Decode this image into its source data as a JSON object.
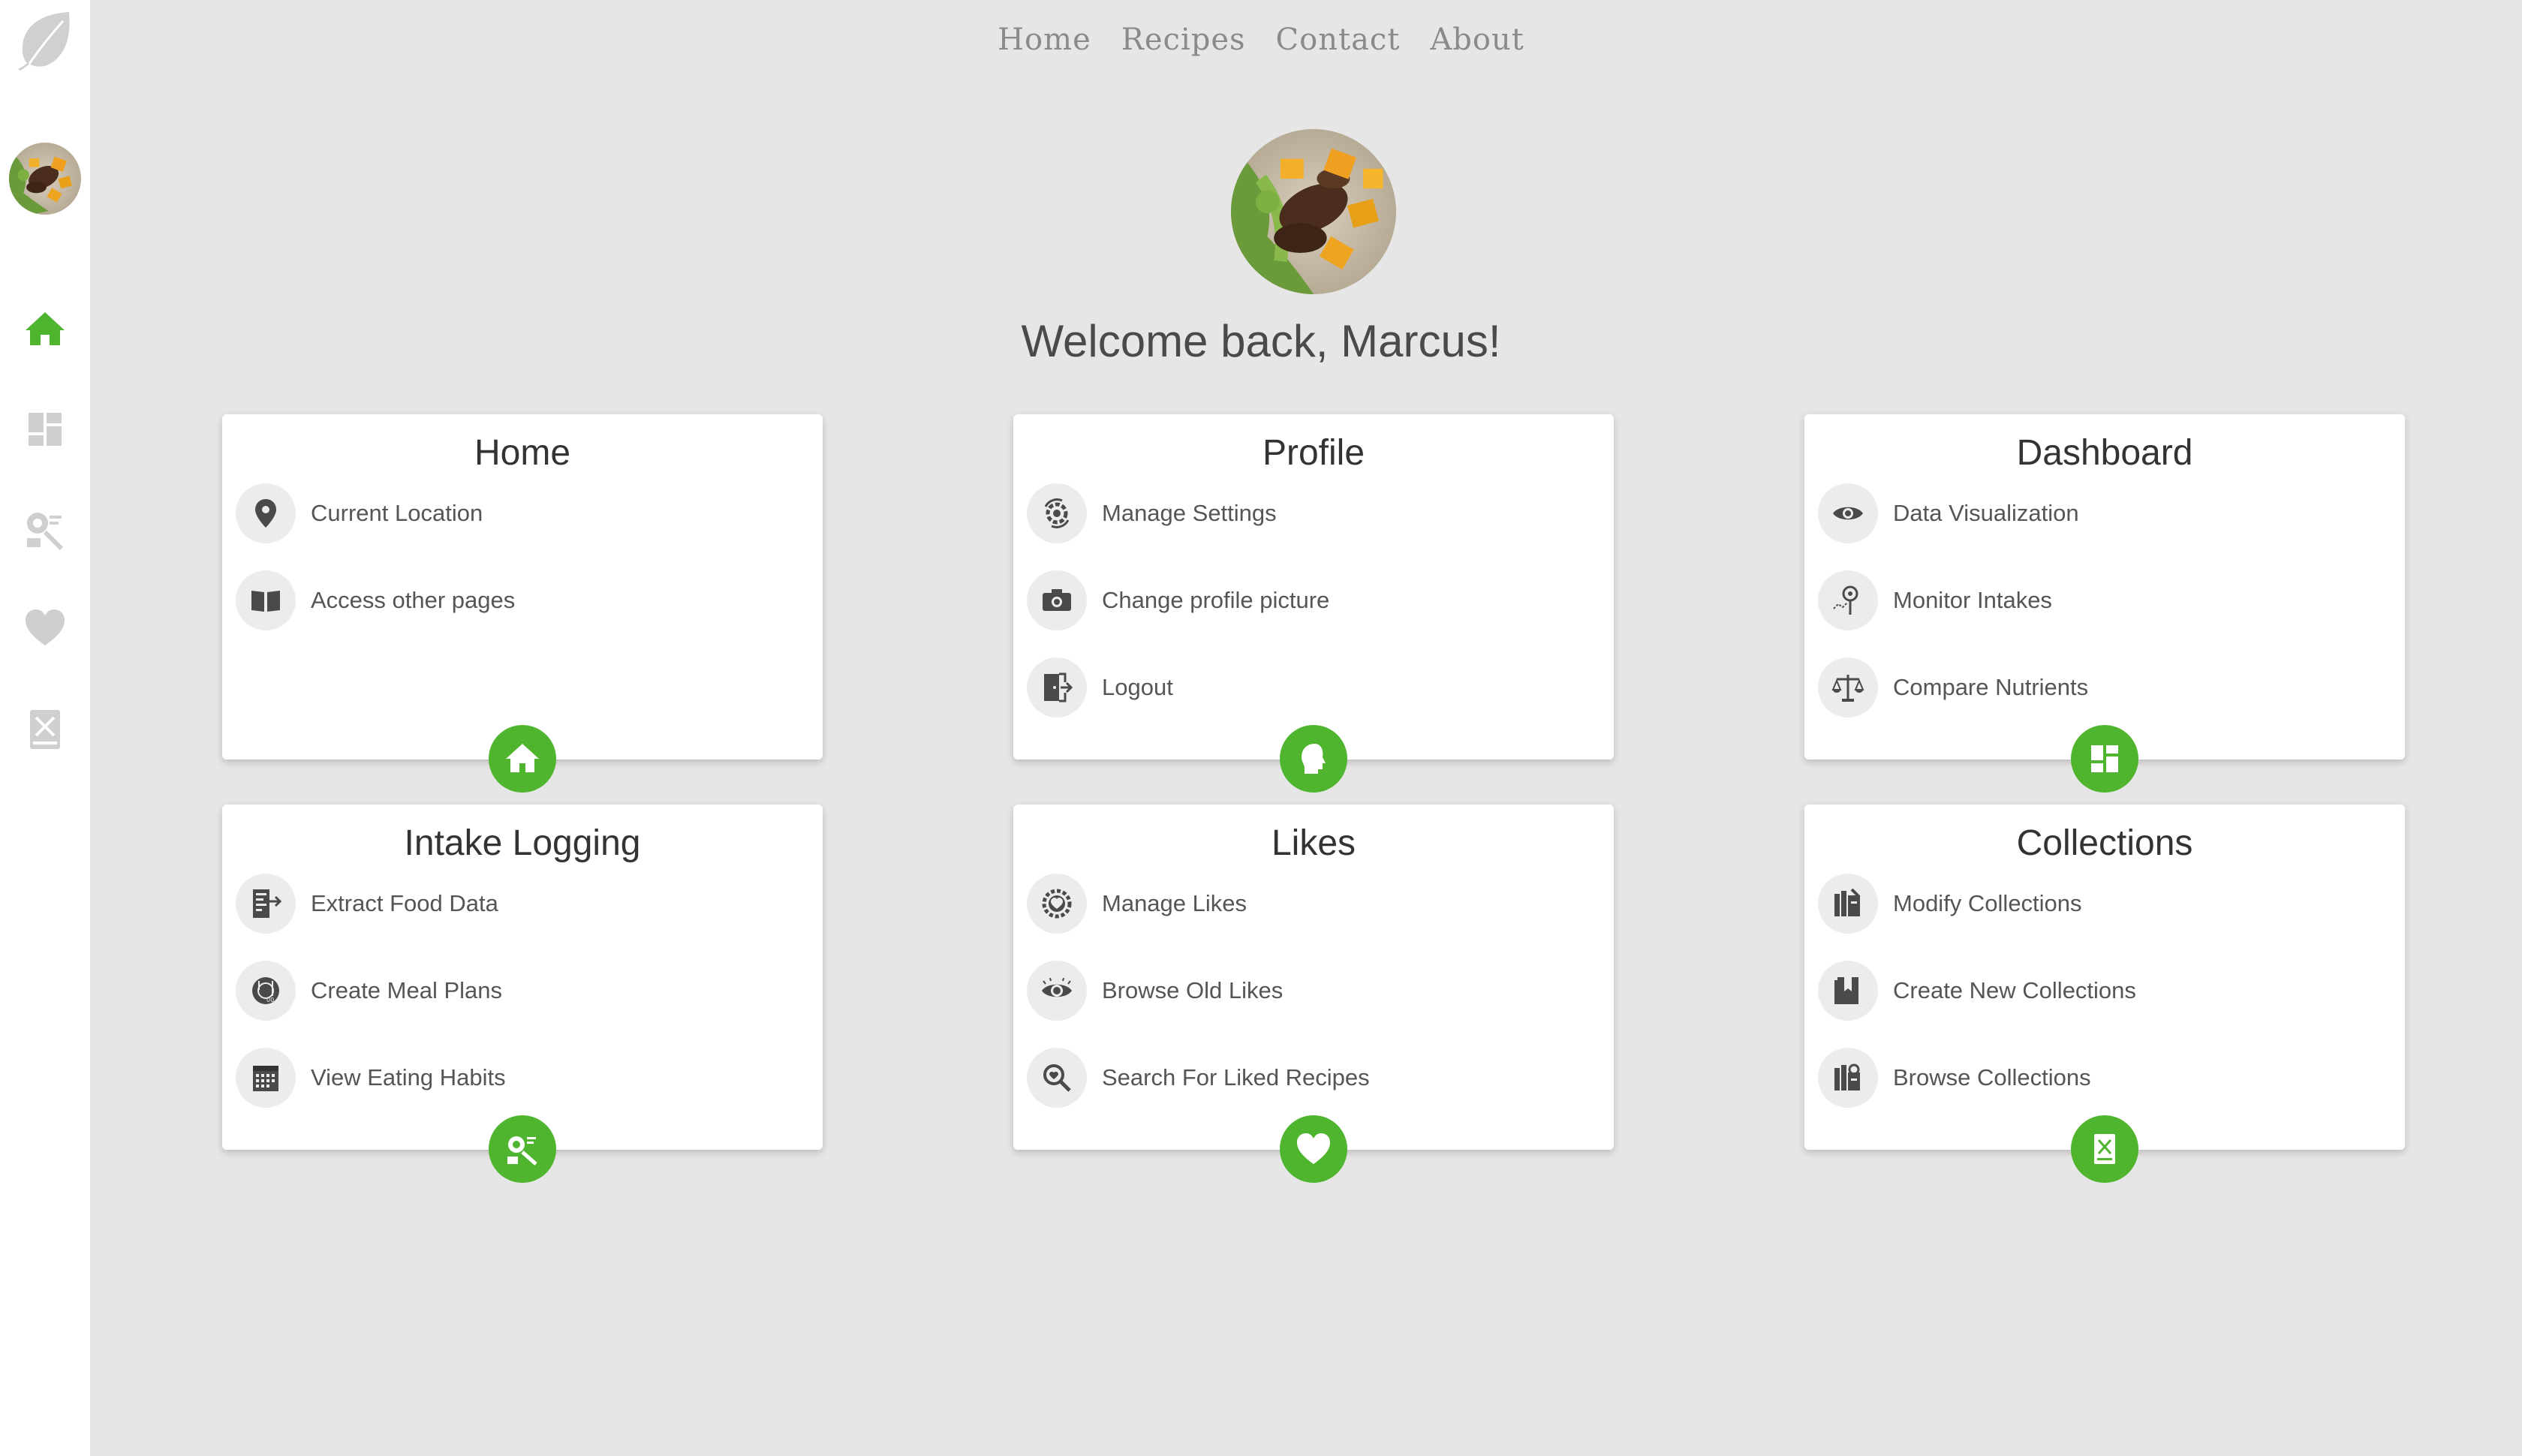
{
  "nav": {
    "links": [
      "Home",
      "Recipes",
      "Contact",
      "About"
    ]
  },
  "welcome": "Welcome back, Marcus!",
  "colors": {
    "accent": "#4fb52e",
    "background": "#e6e6e6",
    "card": "#ffffff",
    "sidebar_icon_inactive": "#cfcfcf"
  },
  "sidebar": {
    "icons": [
      "leaf-icon",
      "avatar",
      "home-icon",
      "dashboard-icon",
      "intake-icon",
      "heart-icon",
      "collections-icon"
    ]
  },
  "cards": [
    {
      "title": "Home",
      "fab_icon": "home-icon",
      "items": [
        {
          "label": "Current Location",
          "icon": "location-pin-icon"
        },
        {
          "label": "Access other pages",
          "icon": "book-icon"
        }
      ]
    },
    {
      "title": "Profile",
      "fab_icon": "head-icon",
      "items": [
        {
          "label": "Manage Settings",
          "icon": "gear-icon"
        },
        {
          "label": "Change profile picture",
          "icon": "camera-icon"
        },
        {
          "label": "Logout",
          "icon": "logout-icon"
        }
      ]
    },
    {
      "title": "Dashboard",
      "fab_icon": "dashboard-icon",
      "items": [
        {
          "label": "Data Visualization",
          "icon": "eye-icon"
        },
        {
          "label": "Monitor Intakes",
          "icon": "monitor-icon"
        },
        {
          "label": "Compare Nutrients",
          "icon": "scale-icon"
        }
      ]
    },
    {
      "title": "Intake Logging",
      "fab_icon": "intake-icon",
      "items": [
        {
          "label": "Extract Food Data",
          "icon": "extract-icon"
        },
        {
          "label": "Create Meal Plans",
          "icon": "meal-plan-icon"
        },
        {
          "label": "View Eating Habits",
          "icon": "calendar-icon"
        }
      ]
    },
    {
      "title": "Likes",
      "fab_icon": "heart-icon",
      "items": [
        {
          "label": "Manage Likes",
          "icon": "manage-likes-icon"
        },
        {
          "label": "Browse Old Likes",
          "icon": "browse-eye-icon"
        },
        {
          "label": "Search For Liked Recipes",
          "icon": "search-icon"
        }
      ]
    },
    {
      "title": "Collections",
      "fab_icon": "collections-icon",
      "items": [
        {
          "label": "Modify Collections",
          "icon": "modify-collection-icon"
        },
        {
          "label": "Create New Collections",
          "icon": "new-collection-icon"
        },
        {
          "label": "Browse Collections",
          "icon": "browse-collection-icon"
        }
      ]
    }
  ]
}
